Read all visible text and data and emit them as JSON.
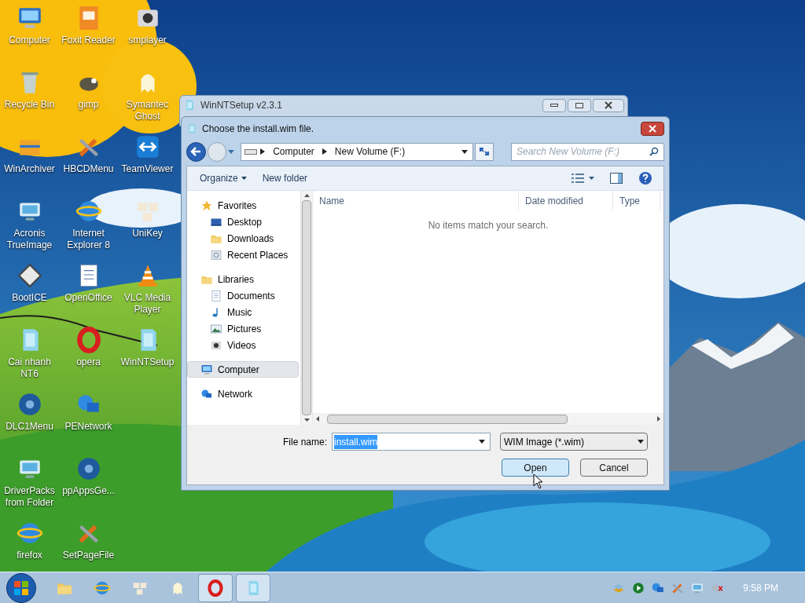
{
  "desktop_icons": [
    {
      "label": "Computer",
      "kind": "computer"
    },
    {
      "label": "Foxit Reader",
      "kind": "pdf"
    },
    {
      "label": "smplayer",
      "kind": "film"
    },
    {
      "label": "Recycle Bin",
      "kind": "bin"
    },
    {
      "label": "gimp",
      "kind": "paint"
    },
    {
      "label": "Symantec Ghost",
      "kind": "ghost"
    },
    {
      "label": "WinArchiver",
      "kind": "box"
    },
    {
      "label": "HBCDMenu",
      "kind": "tools"
    },
    {
      "label": "TeamViewer",
      "kind": "arrows"
    },
    {
      "label": "Acronis TrueImage",
      "kind": "monitor"
    },
    {
      "label": "Internet Explorer 8",
      "kind": "globe"
    },
    {
      "label": "UniKey",
      "kind": "keys"
    },
    {
      "label": "BootICE",
      "kind": "disk"
    },
    {
      "label": "OpenOffice",
      "kind": "doc"
    },
    {
      "label": "VLC Media Player",
      "kind": "cone"
    },
    {
      "label": "Cai nhanh NT6",
      "kind": "setup"
    },
    {
      "label": "opera",
      "kind": "ring"
    },
    {
      "label": "WinNTSetup",
      "kind": "setup"
    },
    {
      "label": "DLC1Menu",
      "kind": "disc"
    },
    {
      "label": "PENetwork",
      "kind": "network"
    },
    {
      "kind": "none"
    },
    {
      "label": "DriverPacks from Folder",
      "kind": "monitor"
    },
    {
      "label": "ppAppsGe...",
      "kind": "disc"
    },
    {
      "kind": "none"
    },
    {
      "label": "firefox",
      "kind": "globe"
    },
    {
      "label": "SetPageFile",
      "kind": "tools"
    }
  ],
  "background_window": {
    "title": "WinNTSetup v2.3.1"
  },
  "dialog": {
    "title": "Choose the install.wim file.",
    "breadcrumb": [
      "Computer",
      "New Volume (F:)"
    ],
    "search": {
      "placeholder": "Search New Volume (F:)"
    },
    "toolbar": [
      {
        "label": "Organize",
        "dropdown": true
      },
      {
        "label": "New folder",
        "dropdown": false
      }
    ],
    "nav_pane": [
      {
        "label": "Favorites",
        "kind": "star",
        "selected": false,
        "children": [
          {
            "label": "Desktop",
            "kind": "desktop",
            "selected": false
          },
          {
            "label": "Downloads",
            "kind": "folder",
            "selected": false
          },
          {
            "label": "Recent Places",
            "kind": "recent",
            "selected": false
          }
        ]
      },
      {
        "label": "Libraries",
        "kind": "folder",
        "selected": false,
        "children": [
          {
            "label": "Documents",
            "kind": "doc",
            "selected": false
          },
          {
            "label": "Music",
            "kind": "note",
            "selected": false
          },
          {
            "label": "Pictures",
            "kind": "picture",
            "selected": false
          },
          {
            "label": "Videos",
            "kind": "film",
            "selected": false
          }
        ]
      },
      {
        "label": "Computer",
        "kind": "computer",
        "selected": true
      },
      {
        "label": "Network",
        "kind": "network",
        "selected": false
      }
    ],
    "columns": [
      "Name",
      "Date modified",
      "Type"
    ],
    "empty_message": "No items match your search.",
    "file_name": {
      "label": "File name:",
      "value": "install.wim",
      "text_selected": true
    },
    "file_type": "WIM Image (*.wim)",
    "buttons": [
      {
        "label": "Open",
        "default": true
      },
      {
        "label": "Cancel",
        "default": false
      }
    ]
  },
  "taskbar": {
    "items": [
      {
        "kind": "folder",
        "active": false
      },
      {
        "kind": "globe",
        "active": false
      },
      {
        "kind": "keys",
        "active": false
      },
      {
        "kind": "ghost",
        "active": false
      },
      {
        "kind": "ring",
        "active": true
      },
      {
        "kind": "setup",
        "active": true
      }
    ],
    "tray": [
      {
        "kind": "stack"
      },
      {
        "kind": "play"
      },
      {
        "kind": "network"
      },
      {
        "kind": "tools"
      },
      {
        "kind": "monitor"
      },
      {
        "kind": "mute"
      }
    ],
    "clock": "9:58 PM"
  }
}
